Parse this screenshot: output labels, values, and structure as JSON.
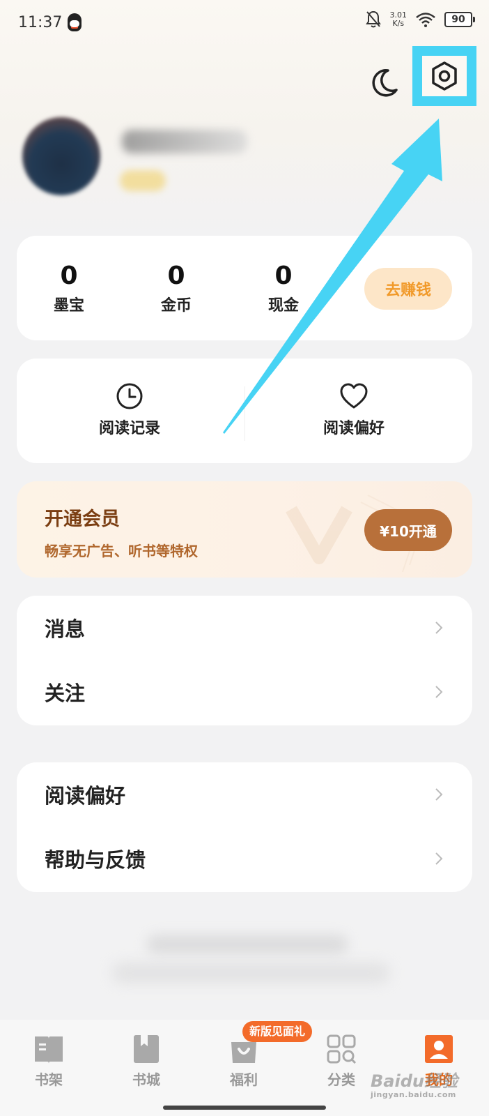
{
  "status_bar": {
    "time": "11:37",
    "net_speed_value": "3.01",
    "net_speed_unit": "K/s",
    "battery": "90"
  },
  "header": {
    "icons": [
      "moon-icon",
      "settings-icon"
    ]
  },
  "assets": {
    "items": [
      {
        "value": "0",
        "label": "墨宝"
      },
      {
        "value": "0",
        "label": "金币"
      },
      {
        "value": "0",
        "label": "现金"
      }
    ],
    "earn_button": "去赚钱"
  },
  "reading": {
    "history_label": "阅读记录",
    "preference_label": "阅读偏好"
  },
  "vip": {
    "title": "开通会员",
    "subtitle": "畅享无广告、听书等特权",
    "button": "¥10开通"
  },
  "list1": {
    "items": [
      "消息",
      "关注"
    ]
  },
  "list2": {
    "items": [
      "阅读偏好",
      "帮助与反馈"
    ]
  },
  "tabs": {
    "items": [
      {
        "label": "书架",
        "icon": "bookshelf-icon"
      },
      {
        "label": "书城",
        "icon": "bookstore-icon"
      },
      {
        "label": "福利",
        "icon": "gift-bag-icon"
      },
      {
        "label": "分类",
        "icon": "category-grid-icon"
      },
      {
        "label": "我的",
        "icon": "profile-icon"
      }
    ],
    "badge": "新版见面礼",
    "active": "我的"
  },
  "watermark": {
    "brand": "Baidu经验",
    "url": "jingyan.baidu.com"
  },
  "colors": {
    "highlight": "#47d3f4",
    "accent": "#e86a1a",
    "vip_brown": "#b8703a"
  }
}
